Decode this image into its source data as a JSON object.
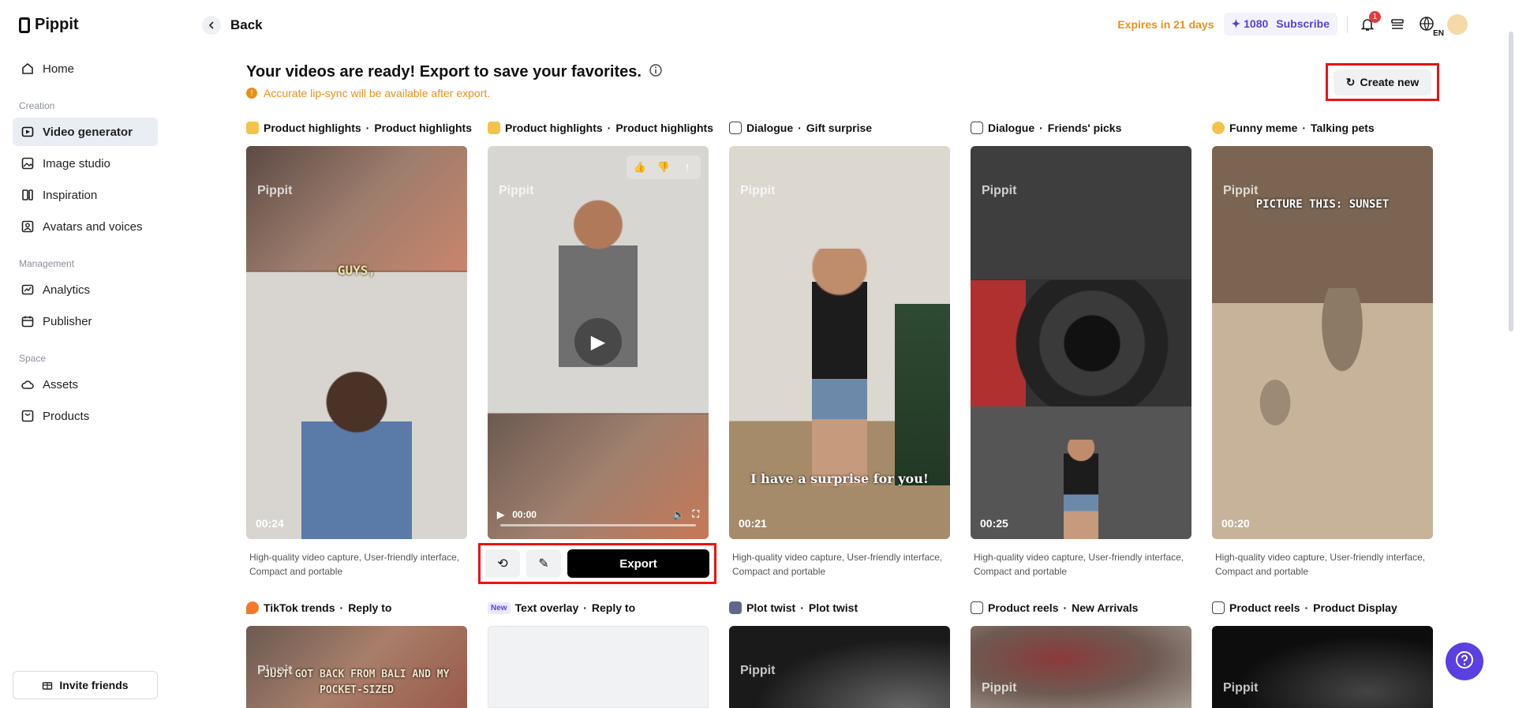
{
  "app": {
    "name": "Pippit"
  },
  "sidebar": {
    "home": "Home",
    "section_creation": "Creation",
    "video_generator": "Video generator",
    "image_studio": "Image studio",
    "inspiration": "Inspiration",
    "avatars": "Avatars and voices",
    "section_management": "Management",
    "analytics": "Analytics",
    "publisher": "Publisher",
    "section_space": "Space",
    "assets": "Assets",
    "products": "Products",
    "invite": "Invite friends"
  },
  "header": {
    "back": "Back",
    "expires": "Expires in 21 days",
    "credits": "1080",
    "subscribe": "Subscribe",
    "notifications_count": "1",
    "language": "EN"
  },
  "main": {
    "heading": "Your videos are ready! Export to save your favorites.",
    "notice": "Accurate lip-sync will be available after export.",
    "create_new": "Create new",
    "watermark": "Pippit",
    "export": "Export",
    "player_time": "00:00",
    "cards": [
      {
        "category": "Product highlights",
        "template": "Product highlights",
        "duration": "00:24",
        "caption": "GUYS,",
        "desc": "High-quality video capture, User-friendly interface, Compact and portable",
        "color": "#6d5a4c"
      },
      {
        "category": "Product highlights",
        "template": "Product highlights",
        "duration": "",
        "caption": "",
        "desc": "",
        "color": "#8a8680"
      },
      {
        "category": "Dialogue",
        "template": "Gift surprise",
        "duration": "00:21",
        "caption": "I have a surprise for you!",
        "desc": "High-quality video capture, User-friendly interface, Compact and portable",
        "color": "#c9c2b6"
      },
      {
        "category": "Dialogue",
        "template": "Friends' picks",
        "duration": "00:25",
        "caption": "",
        "desc": "High-quality video capture, User-friendly interface, Compact and portable",
        "color": "#4f4f4f"
      },
      {
        "category": "Funny meme",
        "template": "Talking pets",
        "duration": "00:20",
        "caption": "PICTURE THIS: SUNSET",
        "desc": "High-quality video capture, User-friendly interface, Compact and portable",
        "color": "#8f7a62"
      }
    ],
    "row2": [
      {
        "category": "TikTok trends",
        "template": "Reply to",
        "caption": "JUST GOT BACK FROM BALI AND MY POCKET-SIZED",
        "color": "#7a6a60"
      },
      {
        "badge": "New",
        "category": "Text overlay",
        "template": "Reply to",
        "color": "#f1f2f4"
      },
      {
        "category": "Plot twist",
        "template": "Plot twist",
        "color": "#1a1a1a"
      },
      {
        "category": "Product reels",
        "template": "New Arrivals",
        "color": "#6e5a52"
      },
      {
        "category": "Product reels",
        "template": "Product Display",
        "color": "#111111"
      }
    ]
  }
}
